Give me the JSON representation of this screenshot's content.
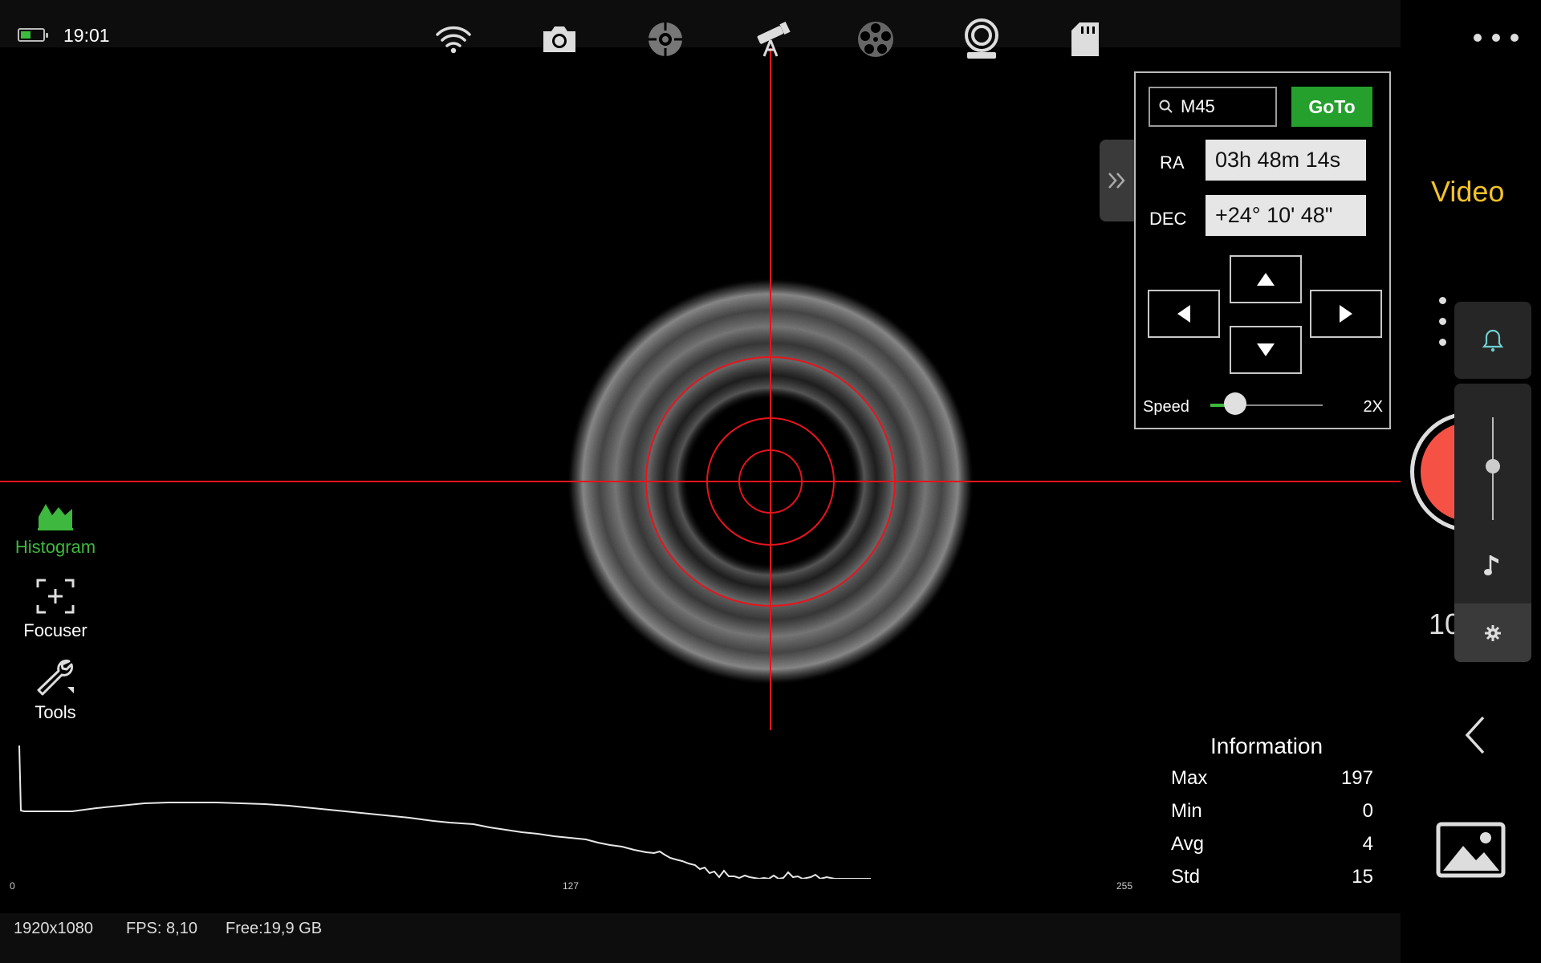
{
  "status": {
    "time": "19:01",
    "battery_level": 0.45
  },
  "topbar": {
    "icons": [
      "wifi-icon",
      "camera-icon",
      "target-icon",
      "telescope-icon",
      "filter-wheel-icon",
      "webcam-icon",
      "sd-card-icon"
    ],
    "more_icon": "more-horizontal-icon"
  },
  "left_tools": [
    {
      "label": "Histogram",
      "icon": "histogram-icon",
      "active": true
    },
    {
      "label": "Focuser",
      "icon": "focuser-icon",
      "active": false
    },
    {
      "label": "Tools",
      "icon": "wrench-icon",
      "active": false
    }
  ],
  "goto_panel": {
    "search_value": "M45",
    "goto_label": "GoTo",
    "ra_label": "RA",
    "ra_value": "03h 48m 14s",
    "dec_label": "DEC",
    "dec_value": "+24° 10' 48\"",
    "speed_label": "Speed",
    "speed_value": "2X",
    "collapse_icon": "double-chevron-right-icon"
  },
  "right_panel": {
    "mode": "Video",
    "resolution_partial": "1080P"
  },
  "information": {
    "title": "Information",
    "rows": [
      {
        "key": "Max",
        "value": "197"
      },
      {
        "key": "Min",
        "value": "0"
      },
      {
        "key": "Avg",
        "value": "4"
      },
      {
        "key": "Std",
        "value": "15"
      }
    ]
  },
  "histogram": {
    "ticks": [
      "0",
      "127",
      "255"
    ]
  },
  "footer": {
    "resolution": "1920x1080",
    "fps": "FPS: 8,10",
    "free": "Free:19,9 GB"
  },
  "colors": {
    "accent_green": "#25a02d",
    "crosshair_red": "#e8141c",
    "mode_yellow": "#f3c229",
    "record_red": "#f55245"
  }
}
